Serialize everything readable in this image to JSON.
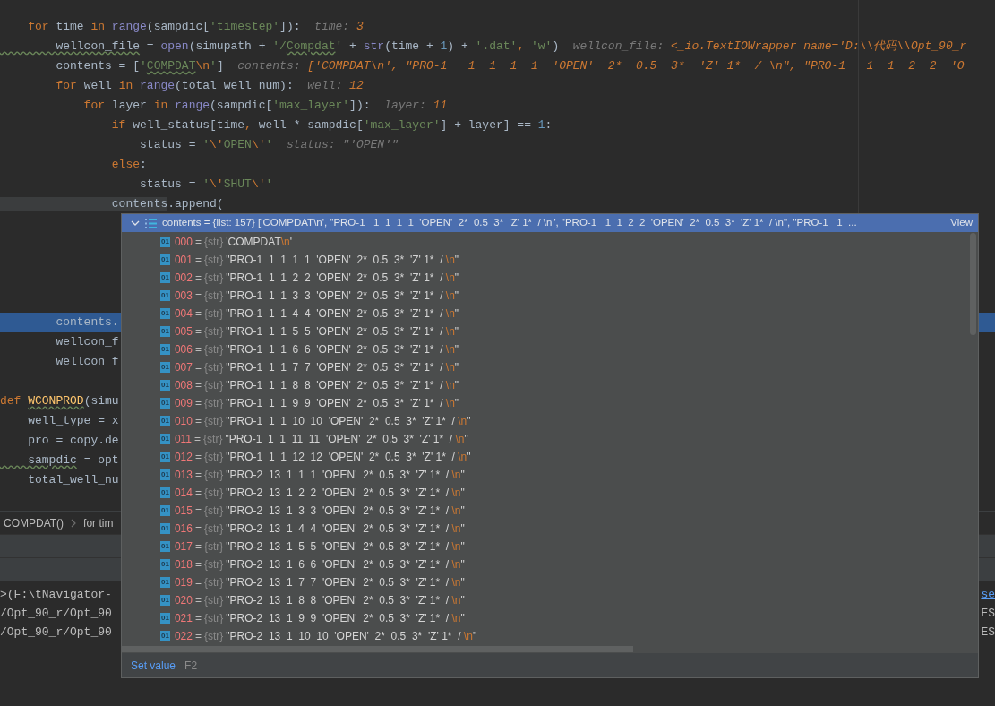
{
  "editor": {
    "lines": [
      {
        "kind": "code",
        "tokens": [
          {
            "t": "    for",
            "kind": "kw"
          },
          {
            "t": " time ",
            "kind": "id"
          },
          {
            "t": "in ",
            "kind": "kw"
          },
          {
            "t": "range",
            "kind": "fn"
          },
          {
            "t": "(sampdic[",
            "kind": "id"
          },
          {
            "t": "'timestep'",
            "kind": "str"
          },
          {
            "t": "]):",
            "kind": "id"
          },
          {
            "t": "  time: ",
            "kind": "hint"
          },
          {
            "t": "3",
            "kind": "hintval"
          }
        ]
      },
      {
        "kind": "code",
        "tokens": [
          {
            "t": "        wellcon_file",
            "kind": "id_typo"
          },
          {
            "t": " = ",
            "kind": "id"
          },
          {
            "t": "open",
            "kind": "fn"
          },
          {
            "t": "(simupath + ",
            "kind": "id"
          },
          {
            "t": "'/",
            "kind": "str"
          },
          {
            "t": "Compdat",
            "kind": "str_typo"
          },
          {
            "t": "'",
            "kind": "str"
          },
          {
            "t": " + ",
            "kind": "id"
          },
          {
            "t": "str",
            "kind": "fn"
          },
          {
            "t": "(time + ",
            "kind": "id"
          },
          {
            "t": "1",
            "kind": "num"
          },
          {
            "t": ") + ",
            "kind": "id"
          },
          {
            "t": "'.dat'",
            "kind": "str"
          },
          {
            "t": ", ",
            "kind": "kw"
          },
          {
            "t": "'w'",
            "kind": "str"
          },
          {
            "t": ")",
            "kind": "id"
          },
          {
            "t": "  wellcon_file: ",
            "kind": "hint"
          },
          {
            "t": "<_io.TextIOWrapper name='D:\\\\代码\\\\Opt_90_r",
            "kind": "hintval"
          }
        ]
      },
      {
        "kind": "code",
        "tokens": [
          {
            "t": "        contents = [",
            "kind": "id"
          },
          {
            "t": "'",
            "kind": "str"
          },
          {
            "t": "COMPDAT",
            "kind": "str_typo"
          },
          {
            "t": "\\n",
            "kind": "esc"
          },
          {
            "t": "'",
            "kind": "str"
          },
          {
            "t": "]",
            "kind": "id"
          },
          {
            "t": "  contents: ",
            "kind": "hint"
          },
          {
            "t": "['COMPDAT\\n', \"PRO-1   1  1  1  1  'OPEN'  2*  0.5  3*  'Z' 1*  / \\n\", \"PRO-1   1  1  2  2  'O",
            "kind": "hintval"
          }
        ]
      },
      {
        "kind": "code",
        "tokens": [
          {
            "t": "        for",
            "kind": "kw"
          },
          {
            "t": " well ",
            "kind": "id"
          },
          {
            "t": "in ",
            "kind": "kw"
          },
          {
            "t": "range",
            "kind": "fn"
          },
          {
            "t": "(total_well_num):",
            "kind": "id"
          },
          {
            "t": "  well: ",
            "kind": "hint"
          },
          {
            "t": "12",
            "kind": "hintval"
          }
        ]
      },
      {
        "kind": "code",
        "tokens": [
          {
            "t": "            for",
            "kind": "kw"
          },
          {
            "t": " layer ",
            "kind": "id"
          },
          {
            "t": "in ",
            "kind": "kw"
          },
          {
            "t": "range",
            "kind": "fn"
          },
          {
            "t": "(sampdic[",
            "kind": "id"
          },
          {
            "t": "'max_layer'",
            "kind": "str"
          },
          {
            "t": "]):",
            "kind": "id"
          },
          {
            "t": "  layer: ",
            "kind": "hint"
          },
          {
            "t": "11",
            "kind": "hintval"
          }
        ]
      },
      {
        "kind": "code",
        "tokens": [
          {
            "t": "                if",
            "kind": "kw"
          },
          {
            "t": " well_status[time",
            "kind": "id"
          },
          {
            "t": ",",
            "kind": "kw"
          },
          {
            "t": " well * sampdic[",
            "kind": "id"
          },
          {
            "t": "'max_layer'",
            "kind": "str"
          },
          {
            "t": "] + layer] == ",
            "kind": "id"
          },
          {
            "t": "1",
            "kind": "num"
          },
          {
            "t": ":",
            "kind": "id"
          }
        ]
      },
      {
        "kind": "code",
        "tokens": [
          {
            "t": "                    status = ",
            "kind": "id"
          },
          {
            "t": "'",
            "kind": "str"
          },
          {
            "t": "\\'",
            "kind": "esc"
          },
          {
            "t": "OPEN",
            "kind": "str"
          },
          {
            "t": "\\'",
            "kind": "esc"
          },
          {
            "t": "'",
            "kind": "str"
          },
          {
            "t": "  status: \"'OPEN'\"",
            "kind": "hint"
          }
        ]
      },
      {
        "kind": "code",
        "tokens": [
          {
            "t": "                else",
            "kind": "kw"
          },
          {
            "t": ":",
            "kind": "id"
          }
        ]
      },
      {
        "kind": "code",
        "tokens": [
          {
            "t": "                    status = ",
            "kind": "id"
          },
          {
            "t": "'",
            "kind": "str"
          },
          {
            "t": "\\'",
            "kind": "esc"
          },
          {
            "t": "SHUT",
            "kind": "str"
          },
          {
            "t": "\\'",
            "kind": "esc"
          },
          {
            "t": "'",
            "kind": "str"
          }
        ]
      },
      {
        "kind": "code",
        "tokens": [
          {
            "t": "                contents",
            "kind": "id_hl"
          },
          {
            "t": ".append(",
            "kind": "id"
          }
        ]
      },
      {
        "kind": "blank"
      },
      {
        "kind": "blank"
      },
      {
        "kind": "blank"
      },
      {
        "kind": "blank"
      },
      {
        "kind": "blank"
      },
      {
        "kind": "current",
        "tokens": [
          {
            "t": "        contents.",
            "kind": "id"
          }
        ]
      },
      {
        "kind": "code",
        "tokens": [
          {
            "t": "        wellcon_f",
            "kind": "id"
          }
        ]
      },
      {
        "kind": "code",
        "tokens": [
          {
            "t": "        wellcon_f",
            "kind": "id"
          }
        ]
      },
      {
        "kind": "blank"
      },
      {
        "kind": "code",
        "tokens": [
          {
            "t": "def ",
            "kind": "kw"
          },
          {
            "t": "WCONPROD",
            "kind": "def_typo"
          },
          {
            "t": "(simu",
            "kind": "id"
          }
        ]
      },
      {
        "kind": "code",
        "tokens": [
          {
            "t": "    well_type = x",
            "kind": "id"
          }
        ]
      },
      {
        "kind": "code",
        "tokens": [
          {
            "t": "    pro = copy.de",
            "kind": "id"
          }
        ]
      },
      {
        "kind": "code",
        "tokens": [
          {
            "t": "    sampdic",
            "kind": "id_typo"
          },
          {
            "t": " = opt",
            "kind": "id"
          }
        ]
      },
      {
        "kind": "code",
        "tokens": [
          {
            "t": "    total_well_nu",
            "kind": "id"
          }
        ]
      }
    ]
  },
  "breadcrumb": [
    "COMPDAT()",
    "for tim"
  ],
  "console": {
    "lines": [
      {
        "left": ">(F:\\tNavigator-",
        "right": "se",
        "right_link": true
      },
      {
        "left": "/Opt_90_r/Opt_90",
        "right": "ES",
        "right_link": false
      },
      {
        "left": "/Opt_90_r/Opt_90",
        "right": "ES",
        "right_link": false
      }
    ]
  },
  "popup": {
    "header": {
      "expanded": true,
      "text": "contents = {list: 157} ['COMPDAT\\n', \"PRO-1   1  1  1  1  'OPEN'  2*  0.5  3*  'Z' 1*  / \\n\", \"PRO-1   1  1  2  2  'OPEN'  2*  0.5  3*  'Z' 1*  / \\n\", \"PRO-1   1  ...",
      "link": "View"
    },
    "rows": [
      {
        "badge": "01",
        "index": "000",
        "eq": "=",
        "type": "{str}",
        "value": "'COMPDAT",
        "escape": "\\n",
        "end": "'"
      },
      {
        "badge": "01",
        "index": "001",
        "eq": "=",
        "type": "{str}",
        "value": "\"PRO-1  1  1  1  1  'OPEN'  2*  0.5  3*  'Z' 1*  / ",
        "escape": "\\n",
        "end": "\""
      },
      {
        "badge": "01",
        "index": "002",
        "eq": "=",
        "type": "{str}",
        "value": "\"PRO-1  1  1  2  2  'OPEN'  2*  0.5  3*  'Z' 1*  / ",
        "escape": "\\n",
        "end": "\""
      },
      {
        "badge": "01",
        "index": "003",
        "eq": "=",
        "type": "{str}",
        "value": "\"PRO-1  1  1  3  3  'OPEN'  2*  0.5  3*  'Z' 1*  / ",
        "escape": "\\n",
        "end": "\""
      },
      {
        "badge": "01",
        "index": "004",
        "eq": "=",
        "type": "{str}",
        "value": "\"PRO-1  1  1  4  4  'OPEN'  2*  0.5  3*  'Z' 1*  / ",
        "escape": "\\n",
        "end": "\""
      },
      {
        "badge": "01",
        "index": "005",
        "eq": "=",
        "type": "{str}",
        "value": "\"PRO-1  1  1  5  5  'OPEN'  2*  0.5  3*  'Z' 1*  / ",
        "escape": "\\n",
        "end": "\""
      },
      {
        "badge": "01",
        "index": "006",
        "eq": "=",
        "type": "{str}",
        "value": "\"PRO-1  1  1  6  6  'OPEN'  2*  0.5  3*  'Z' 1*  / ",
        "escape": "\\n",
        "end": "\""
      },
      {
        "badge": "01",
        "index": "007",
        "eq": "=",
        "type": "{str}",
        "value": "\"PRO-1  1  1  7  7  'OPEN'  2*  0.5  3*  'Z' 1*  / ",
        "escape": "\\n",
        "end": "\""
      },
      {
        "badge": "01",
        "index": "008",
        "eq": "=",
        "type": "{str}",
        "value": "\"PRO-1  1  1  8  8  'OPEN'  2*  0.5  3*  'Z' 1*  / ",
        "escape": "\\n",
        "end": "\""
      },
      {
        "badge": "01",
        "index": "009",
        "eq": "=",
        "type": "{str}",
        "value": "\"PRO-1  1  1  9  9  'OPEN'  2*  0.5  3*  'Z' 1*  / ",
        "escape": "\\n",
        "end": "\""
      },
      {
        "badge": "01",
        "index": "010",
        "eq": "=",
        "type": "{str}",
        "value": "\"PRO-1  1  1  10  10  'OPEN'  2*  0.5  3*  'Z' 1*  / ",
        "escape": "\\n",
        "end": "\""
      },
      {
        "badge": "01",
        "index": "011",
        "eq": "=",
        "type": "{str}",
        "value": "\"PRO-1  1  1  11  11  'OPEN'  2*  0.5  3*  'Z' 1*  / ",
        "escape": "\\n",
        "end": "\""
      },
      {
        "badge": "01",
        "index": "012",
        "eq": "=",
        "type": "{str}",
        "value": "\"PRO-1  1  1  12  12  'OPEN'  2*  0.5  3*  'Z' 1*  / ",
        "escape": "\\n",
        "end": "\""
      },
      {
        "badge": "01",
        "index": "013",
        "eq": "=",
        "type": "{str}",
        "value": "\"PRO-2  13  1  1  1  'OPEN'  2*  0.5  3*  'Z' 1*  / ",
        "escape": "\\n",
        "end": "\""
      },
      {
        "badge": "01",
        "index": "014",
        "eq": "=",
        "type": "{str}",
        "value": "\"PRO-2  13  1  2  2  'OPEN'  2*  0.5  3*  'Z' 1*  / ",
        "escape": "\\n",
        "end": "\""
      },
      {
        "badge": "01",
        "index": "015",
        "eq": "=",
        "type": "{str}",
        "value": "\"PRO-2  13  1  3  3  'OPEN'  2*  0.5  3*  'Z' 1*  / ",
        "escape": "\\n",
        "end": "\""
      },
      {
        "badge": "01",
        "index": "016",
        "eq": "=",
        "type": "{str}",
        "value": "\"PRO-2  13  1  4  4  'OPEN'  2*  0.5  3*  'Z' 1*  / ",
        "escape": "\\n",
        "end": "\""
      },
      {
        "badge": "01",
        "index": "017",
        "eq": "=",
        "type": "{str}",
        "value": "\"PRO-2  13  1  5  5  'OPEN'  2*  0.5  3*  'Z' 1*  / ",
        "escape": "\\n",
        "end": "\""
      },
      {
        "badge": "01",
        "index": "018",
        "eq": "=",
        "type": "{str}",
        "value": "\"PRO-2  13  1  6  6  'OPEN'  2*  0.5  3*  'Z' 1*  / ",
        "escape": "\\n",
        "end": "\""
      },
      {
        "badge": "01",
        "index": "019",
        "eq": "=",
        "type": "{str}",
        "value": "\"PRO-2  13  1  7  7  'OPEN'  2*  0.5  3*  'Z' 1*  / ",
        "escape": "\\n",
        "end": "\""
      },
      {
        "badge": "01",
        "index": "020",
        "eq": "=",
        "type": "{str}",
        "value": "\"PRO-2  13  1  8  8  'OPEN'  2*  0.5  3*  'Z' 1*  / ",
        "escape": "\\n",
        "end": "\""
      },
      {
        "badge": "01",
        "index": "021",
        "eq": "=",
        "type": "{str}",
        "value": "\"PRO-2  13  1  9  9  'OPEN'  2*  0.5  3*  'Z' 1*  / ",
        "escape": "\\n",
        "end": "\""
      },
      {
        "badge": "01",
        "index": "022",
        "eq": "=",
        "type": "{str}",
        "value": "\"PRO-2  13  1  10  10  'OPEN'  2*  0.5  3*  'Z' 1*  / ",
        "escape": "\\n",
        "end": "\""
      }
    ],
    "footer": {
      "action": "Set value",
      "shortcut": "F2"
    }
  }
}
